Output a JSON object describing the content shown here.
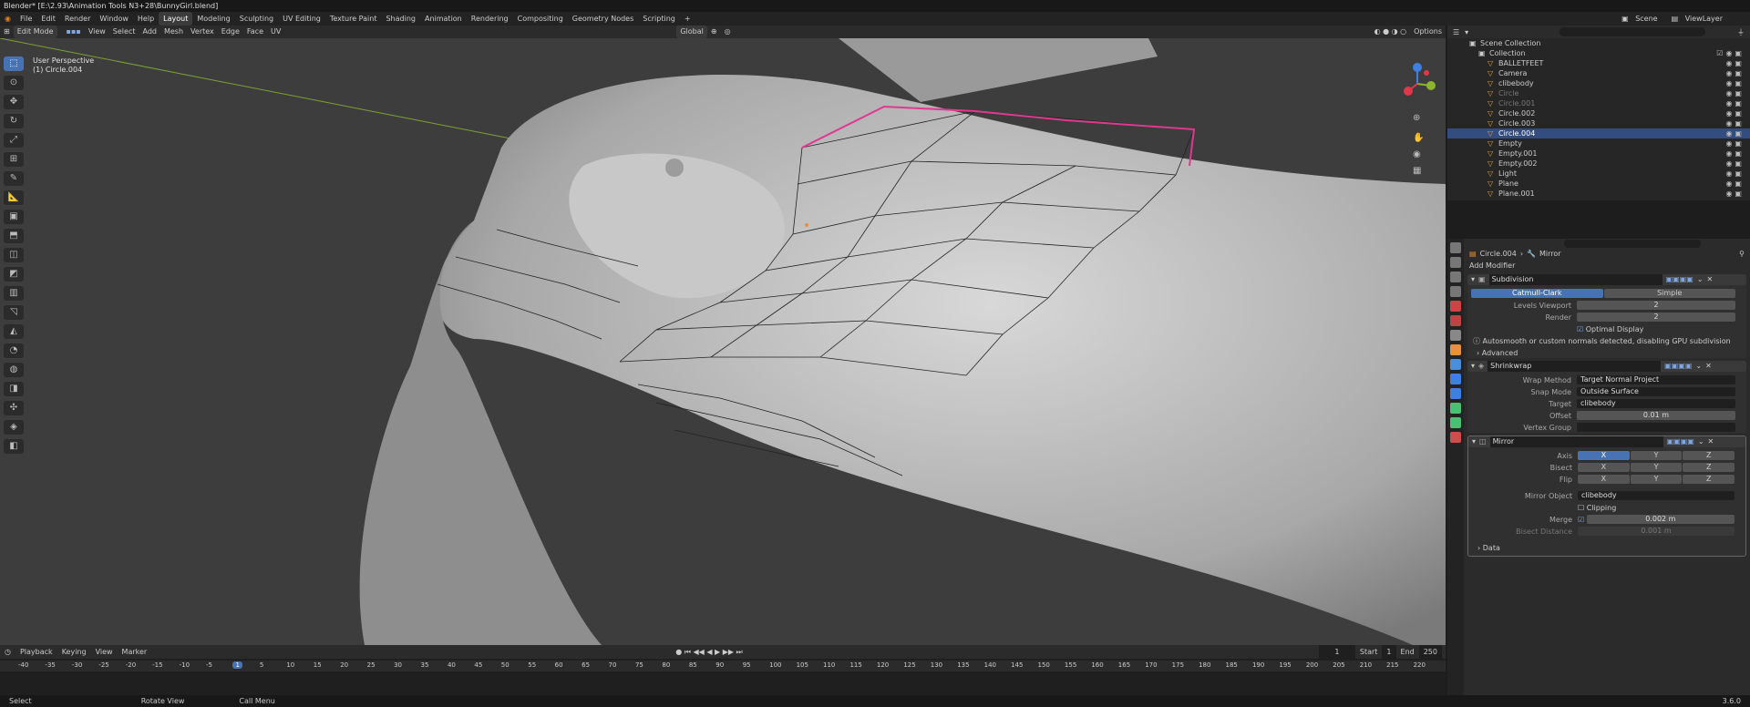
{
  "title": "Blender* [E:\\2.93\\Animation Tools N3+28\\BunnyGirl.blend]",
  "menu": [
    "File",
    "Edit",
    "Render",
    "Window",
    "Help"
  ],
  "workspaces": [
    "Layout",
    "Modeling",
    "Sculpting",
    "UV Editing",
    "Texture Paint",
    "Shading",
    "Animation",
    "Rendering",
    "Compositing",
    "Geometry Nodes",
    "Scripting"
  ],
  "active_workspace": "Layout",
  "scene": "Scene",
  "view_layer": "ViewLayer",
  "viewport_header": {
    "mode": "Edit Mode",
    "menus": [
      "View",
      "Select",
      "Add",
      "Mesh",
      "Vertex",
      "Edge",
      "Face",
      "UV"
    ],
    "orientation": "Global",
    "options": "Options"
  },
  "viewport_label": {
    "line1": "User Perspective",
    "line2": "(1) Circle.004"
  },
  "outliner": {
    "title": "Scene Collection",
    "collection": "Collection",
    "items": [
      {
        "name": "BALLETFEET",
        "sel": false,
        "dim": false
      },
      {
        "name": "Camera",
        "sel": false,
        "dim": false
      },
      {
        "name": "clibebody",
        "sel": false,
        "dim": false
      },
      {
        "name": "Circle",
        "sel": false,
        "dim": true
      },
      {
        "name": "Circle.001",
        "sel": false,
        "dim": true
      },
      {
        "name": "Circle.002",
        "sel": false,
        "dim": false
      },
      {
        "name": "Circle.003",
        "sel": false,
        "dim": false
      },
      {
        "name": "Circle.004",
        "sel": true,
        "dim": false
      },
      {
        "name": "Empty",
        "sel": false,
        "dim": false
      },
      {
        "name": "Empty.001",
        "sel": false,
        "dim": false
      },
      {
        "name": "Empty.002",
        "sel": false,
        "dim": false
      },
      {
        "name": "Light",
        "sel": false,
        "dim": false
      },
      {
        "name": "Plane",
        "sel": false,
        "dim": false
      },
      {
        "name": "Plane.001",
        "sel": false,
        "dim": false
      }
    ]
  },
  "props": {
    "breadcrumb_obj": "Circle.004",
    "breadcrumb_mod": "Mirror",
    "add_modifier": "Add Modifier",
    "subdivision": {
      "name": "Subdivision",
      "catmull": "Catmull-Clark",
      "simple": "Simple",
      "levels_label": "Levels Viewport",
      "levels": "2",
      "render_label": "Render",
      "render": "2",
      "optimal": "Optimal Display",
      "warning": "Autosmooth or custom normals detected, disabling GPU subdivision",
      "advanced": "Advanced"
    },
    "shrinkwrap": {
      "name": "Shrinkwrap",
      "wrap_label": "Wrap Method",
      "wrap": "Target Normal Project",
      "snap_label": "Snap Mode",
      "snap": "Outside Surface",
      "target_label": "Target",
      "target": "clibebody",
      "offset_label": "Offset",
      "offset": "0.01 m",
      "vg_label": "Vertex Group"
    },
    "mirror": {
      "name": "Mirror",
      "axis_label": "Axis",
      "bisect_label": "Bisect",
      "flip_label": "Flip",
      "x": "X",
      "y": "Y",
      "z": "Z",
      "mo_label": "Mirror Object",
      "mo": "clibebody",
      "clipping": "Clipping",
      "merge_label": "Merge",
      "merge": "0.002 m",
      "bisect_dist_label": "Bisect Distance",
      "bisect_dist": "0.001 m",
      "data": "Data"
    }
  },
  "timeline": {
    "menus": [
      "Playback",
      "Keying",
      "View",
      "Marker"
    ],
    "current": "1",
    "start_label": "Start",
    "start": "1",
    "end_label": "End",
    "end": "250",
    "ticks": [
      "-40",
      "-35",
      "-30",
      "-25",
      "-20",
      "-15",
      "-10",
      "-5",
      "1",
      "5",
      "10",
      "15",
      "20",
      "25",
      "30",
      "35",
      "40",
      "45",
      "50",
      "55",
      "60",
      "65",
      "70",
      "75",
      "80",
      "85",
      "90",
      "95",
      "100",
      "105",
      "110",
      "115",
      "120",
      "125",
      "130",
      "135",
      "140",
      "145",
      "150",
      "155",
      "160",
      "165",
      "170",
      "175",
      "180",
      "185",
      "190",
      "195",
      "200",
      "205",
      "210",
      "215",
      "220"
    ]
  },
  "status": {
    "select": "Select",
    "rotate": "Rotate View",
    "call": "Call Menu",
    "version": "3.6.0"
  }
}
